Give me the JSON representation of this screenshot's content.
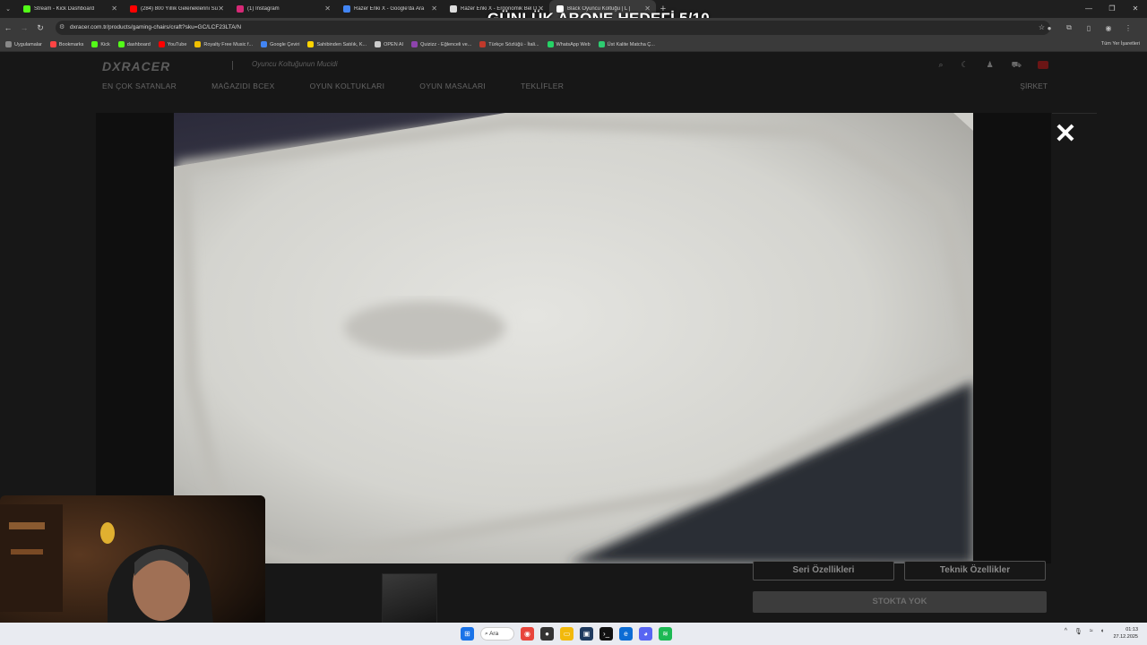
{
  "browser": {
    "tabs": [
      {
        "title": "Stream - Kick Dashboard",
        "color": "#53fc18"
      },
      {
        "title": "(284) 800 Yıllık Geleneklerini Sü",
        "color": "#ff0000"
      },
      {
        "title": "(1) Instagram",
        "color": "#d62976"
      },
      {
        "title": "Razer Enki X - Google'da Ara",
        "color": "#4285f4"
      },
      {
        "title": "Razer Enki X - Ergonomik Bel Dest",
        "color": "#dddddd"
      },
      {
        "title": "Black Oyuncu Koltuğu | L |",
        "color": "#ffffff",
        "active": true
      }
    ],
    "url": "dxracer.com.tr/products/gaming-chairs/craft?sku=GC/LCF23LTA/N",
    "bookmarks": [
      "Uygulamalar",
      "Bookmarks",
      "Kick",
      "dashboard",
      "YouTube",
      "Royalty Free Music f...",
      "Google Çeviri",
      "Sahibinden Satılık, K...",
      "OPEN AI",
      "Quizizz - Eğlenceli ve...",
      "Türkçe Sözlüğü - İtali...",
      "WhatsApp Web",
      "Üst Kalite Matcha Ç..."
    ],
    "bookmark_colors": [
      "#888888",
      "#ff4444",
      "#53fc18",
      "#53fc18",
      "#ff0000",
      "#f0c000",
      "#4285f4",
      "#ffd400",
      "#cccccc",
      "#8e44ad",
      "#c0392b",
      "#25d366",
      "#2ecc71"
    ],
    "all_bookmarks": "Tüm Yer İşaretleri"
  },
  "overlay": {
    "title": "GÜNLÜK ABONE HEDEFİ 5/10"
  },
  "site": {
    "logo": "DXRACER",
    "tagline": "Oyuncu Koltuğunun Mucidi",
    "nav": [
      "EN ÇOK SATANLAR",
      "MAĞAZIDI BCEX",
      "OYUN KOLTUKLARI",
      "OYUN MASALARI",
      "TEKLİFLER"
    ],
    "nav_right": "ŞİRKET",
    "buttons": {
      "series": "Seri Özellikleri",
      "technical": "Teknik Özellikler",
      "stock": "STOKTA YOK"
    }
  },
  "taskbar": {
    "search": "Ara",
    "time": "01:13",
    "date": "27.12.2025"
  }
}
